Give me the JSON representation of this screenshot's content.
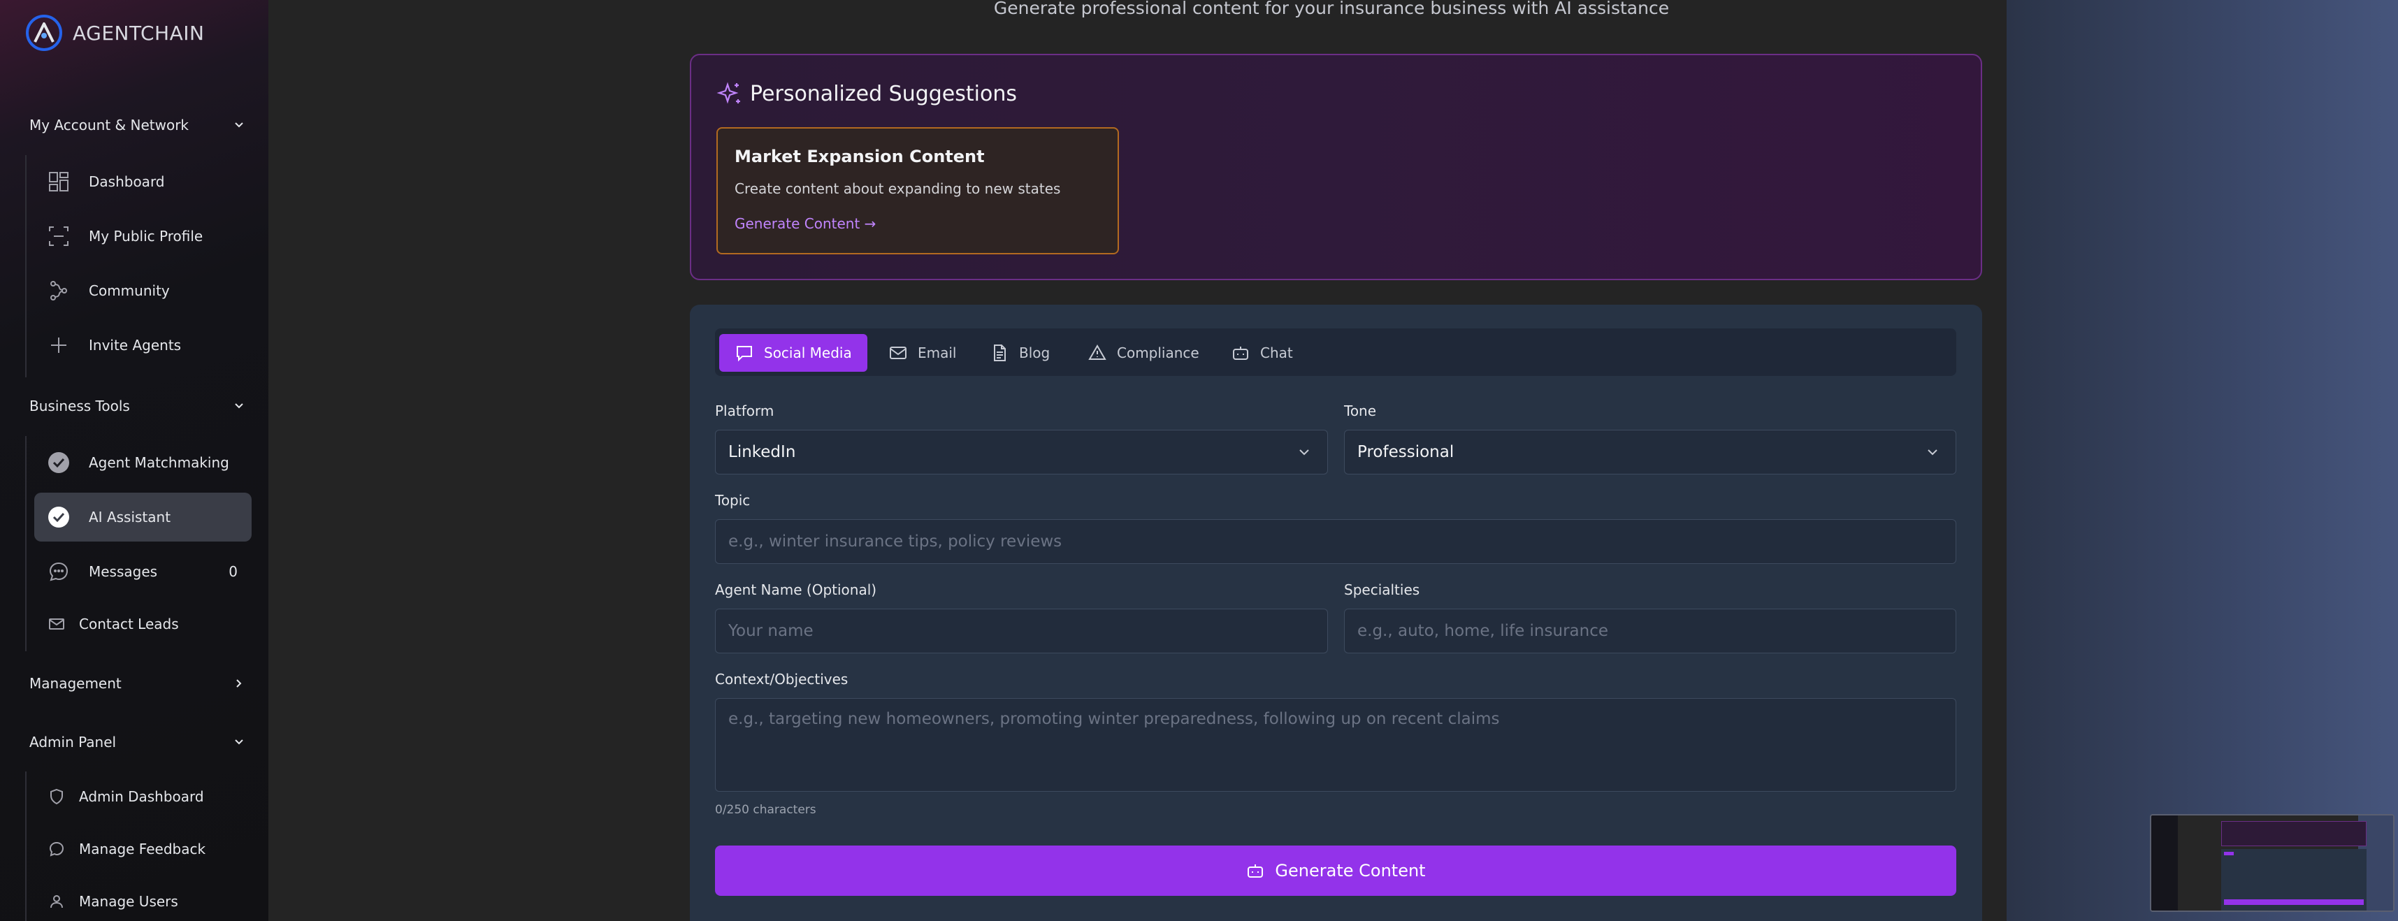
{
  "brand": {
    "name": "AGENTCHAIN"
  },
  "sidebar": {
    "sections": [
      {
        "label": "My Account & Network",
        "expanded": true,
        "items": [
          {
            "label": "Dashboard",
            "icon": "dashboard-grid-icon"
          },
          {
            "label": "My Public Profile",
            "icon": "profile-scan-icon"
          },
          {
            "label": "Community",
            "icon": "network-icon"
          },
          {
            "label": "Invite Agents",
            "icon": "plus-icon"
          }
        ]
      },
      {
        "label": "Business Tools",
        "expanded": true,
        "items": [
          {
            "label": "Agent Matchmaking",
            "icon": "check-circle-icon"
          },
          {
            "label": "AI Assistant",
            "icon": "check-circle-icon",
            "active": true
          },
          {
            "label": "Messages",
            "icon": "message-bubble-icon",
            "badge": "0"
          },
          {
            "label": "Contact Leads",
            "icon": "mail-icon"
          }
        ]
      },
      {
        "label": "Management",
        "expanded": false,
        "items": []
      },
      {
        "label": "Admin Panel",
        "expanded": true,
        "items": [
          {
            "label": "Admin Dashboard",
            "icon": "shield-icon"
          },
          {
            "label": "Manage Feedback",
            "icon": "message-bubble-icon"
          },
          {
            "label": "Manage Users",
            "icon": "user-icon"
          }
        ]
      }
    ]
  },
  "main": {
    "subtitle": "Generate professional content for your insurance business with AI assistance",
    "suggestions": {
      "title": "Personalized Suggestions",
      "card": {
        "title": "Market Expansion Content",
        "description": "Create content about expanding to new states",
        "link": "Generate Content →"
      }
    },
    "tabs": [
      {
        "label": "Social Media",
        "icon": "chat-bubble-icon",
        "active": true
      },
      {
        "label": "Email",
        "icon": "mail-icon"
      },
      {
        "label": "Blog",
        "icon": "document-icon"
      },
      {
        "label": "Compliance",
        "icon": "warning-triangle-icon"
      },
      {
        "label": "Chat",
        "icon": "bot-icon"
      }
    ],
    "form": {
      "platform_label": "Platform",
      "platform_value": "LinkedIn",
      "tone_label": "Tone",
      "tone_value": "Professional",
      "topic_label": "Topic",
      "topic_placeholder": "e.g., winter insurance tips, policy reviews",
      "agent_name_label": "Agent Name (Optional)",
      "agent_name_placeholder": "Your name",
      "specialties_label": "Specialties",
      "specialties_placeholder": "e.g., auto, home, life insurance",
      "context_label": "Context/Objectives",
      "context_placeholder": "e.g., targeting new homeowners, promoting winter preparedness, following up on recent claims",
      "char_counter": "0/250 characters",
      "generate_label": "Generate Content"
    }
  },
  "colors": {
    "accent": "#9333ea",
    "card_border": "#b26a20",
    "suggestions_border": "#6b2e86"
  }
}
